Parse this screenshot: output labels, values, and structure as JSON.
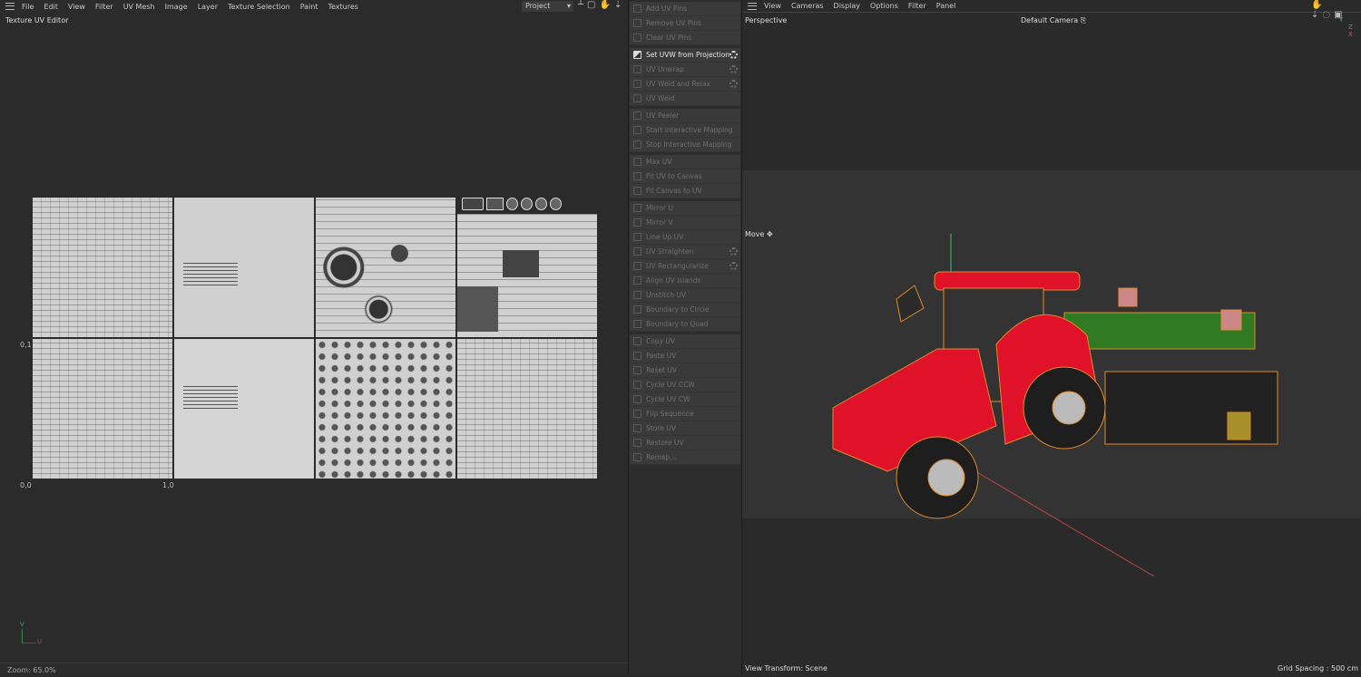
{
  "uv_editor": {
    "menu": [
      "File",
      "Edit",
      "View",
      "Filter",
      "UV Mesh",
      "Image",
      "Layer",
      "Texture Selection",
      "Paint",
      "Textures"
    ],
    "project_select": "Project",
    "title": "Texture UV Editor",
    "axis_labels": {
      "v_mid": "0,1",
      "origin": "0,0",
      "u_mid": "1,0"
    },
    "gizmo": {
      "v": "V",
      "u": "U"
    },
    "zoom_status": "Zoom: 65.0%"
  },
  "commands": {
    "groups": [
      [
        {
          "label": "Add UV Pins"
        },
        {
          "label": "Remove UV Pins"
        },
        {
          "label": "Clear UV Pins"
        }
      ],
      [
        {
          "label": "Set UVW from Projection",
          "active": true,
          "gear": true
        },
        {
          "label": "UV Unwrap",
          "gear": true
        },
        {
          "label": "UV Weld and Relax",
          "gear": true
        },
        {
          "label": "UV Weld"
        }
      ],
      [
        {
          "label": "UV Peeler"
        },
        {
          "label": "Start Interactive Mapping"
        },
        {
          "label": "Stop Interactive Mapping"
        }
      ],
      [
        {
          "label": "Max UV"
        },
        {
          "label": "Fit UV to Canvas"
        },
        {
          "label": "Fit Canvas to UV"
        }
      ],
      [
        {
          "label": "Mirror U"
        },
        {
          "label": "Mirror V"
        },
        {
          "label": "Line Up UV"
        },
        {
          "label": "UV Straighten",
          "gear": true
        },
        {
          "label": "UV Rectangularize",
          "gear": true
        },
        {
          "label": "Align UV Islands"
        },
        {
          "label": "Unstitch UV"
        },
        {
          "label": "Boundary to Circle"
        },
        {
          "label": "Boundary to Quad"
        }
      ],
      [
        {
          "label": "Copy UV"
        },
        {
          "label": "Paste UV"
        },
        {
          "label": "Reset UV"
        },
        {
          "label": "Cycle UV CCW"
        },
        {
          "label": "Cycle UV CW"
        },
        {
          "label": "Flip Sequence"
        },
        {
          "label": "Store UV"
        },
        {
          "label": "Restore UV"
        },
        {
          "label": "Remap..."
        }
      ]
    ]
  },
  "viewport": {
    "menu": [
      "View",
      "Cameras",
      "Display",
      "Options",
      "Filter",
      "Panel"
    ],
    "view_name": "Perspective",
    "camera": "Default Camera",
    "tool": "Move",
    "axes": {
      "y": "Y",
      "z": "Z",
      "x": "X"
    },
    "view_transform": "View Transform: Scene",
    "grid_spacing": "Grid Spacing : 500 cm",
    "colors": {
      "tractor": "#e0122a",
      "implement": "#2f7a22",
      "selection": "#e08a2a"
    }
  }
}
